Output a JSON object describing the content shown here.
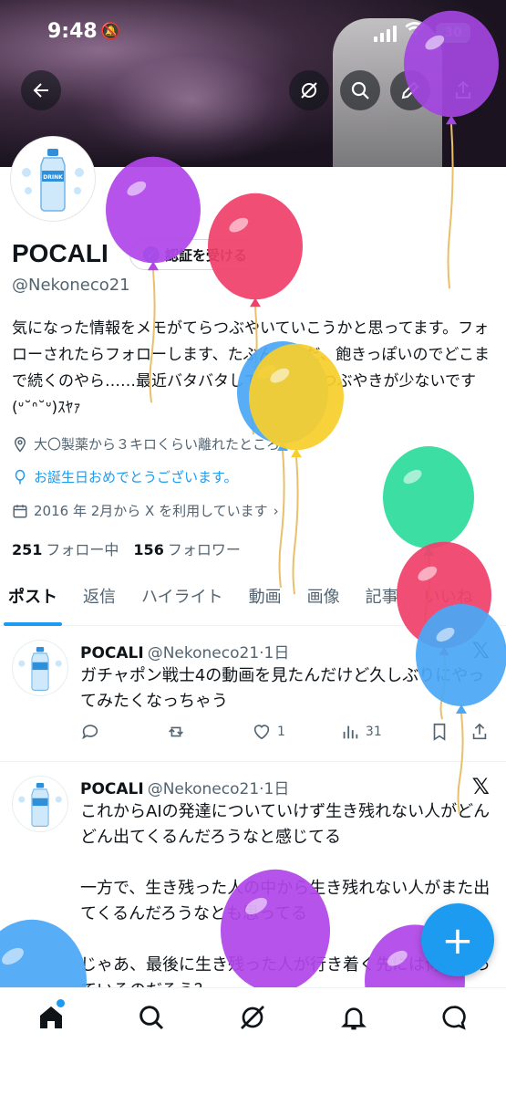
{
  "status_bar": {
    "time": "9:48",
    "battery": "30"
  },
  "colors": {
    "accent": "#1d9bf0",
    "text": "#0f1419",
    "muted": "#536471"
  },
  "header_icons": [
    "back-icon",
    "grok-icon",
    "search-icon",
    "edit-icon",
    "share-icon"
  ],
  "profile": {
    "name": "POCALI",
    "verify_label": "認証を受ける",
    "handle": "@Nekoneco21",
    "bio": "気になった情報をメモがてらつぶやいていこうかと思ってます。フォローされたらフォローします、たぶん。ただ、飽きっぽいのでどこまで続くのやら……最近バタバタしているのでつぶやきが少ないです(ᐡ˘ᐢ˘ᐡ)ｽﾔｧ",
    "location": "大〇製薬から３キロくらい離れたところ",
    "birthday": "お誕生日おめでとうございます。",
    "joined": "2016 年 2月から X を利用しています",
    "following_count": "251",
    "following_label": "フォロー中",
    "followers_count": "156",
    "followers_label": "フォロワー"
  },
  "tabs": [
    "ポスト",
    "返信",
    "ハイライト",
    "動画",
    "画像",
    "記事",
    "いいね"
  ],
  "posts": [
    {
      "name": "POCALI",
      "meta": "@Nekoneco21·1日",
      "body": "ガチャポン戦士4の動画を見たんだけど久しぶりにやってみたくなっちゃう",
      "likes": "1",
      "views": "31"
    },
    {
      "name": "POCALI",
      "meta": "@Nekoneco21·1日",
      "body": "これからAIの発達についていけず生き残れない人がどんどん出てくるんだろうなと感じてる\n\n一方で、生き残った人の中から生き残れない人がまた出てくるんだろうなとも思ってる\n\nじゃあ、最後に生き残った人が行き着く先には何が待っているのだろう？"
    }
  ],
  "fab_label": "+",
  "bottom_nav": [
    "home-icon",
    "search-icon",
    "grok-icon",
    "notifications-icon",
    "messages-icon"
  ],
  "balloons": [
    {
      "color": "#a246e0"
    },
    {
      "color": "#b046e8"
    },
    {
      "color": "#f0416b"
    },
    {
      "color": "#4aa8f5"
    },
    {
      "color": "#f7cf2c"
    },
    {
      "color": "#2ddc9c"
    },
    {
      "color": "#f0416b"
    },
    {
      "color": "#4aa8f5"
    },
    {
      "color": "#b046e8"
    },
    {
      "color": "#b046e8"
    },
    {
      "color": "#4aa8f5"
    }
  ]
}
